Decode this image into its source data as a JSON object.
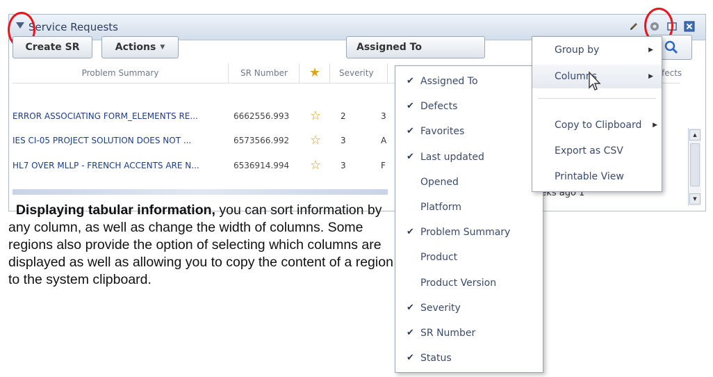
{
  "region": {
    "title": "Service Requests"
  },
  "toolbar": {
    "create_label": "Create SR",
    "actions_label": "Actions",
    "assigned_label": "Assigned To"
  },
  "table": {
    "headers": {
      "summary": "Problem Summary",
      "sr": "SR Number",
      "severity": "Severity",
      "defects": "fects"
    },
    "rows": [
      {
        "summary": "ERROR ASSOCIATING FORM_ELEMENTS RE...",
        "sr": "6662556.993",
        "severity": "2",
        "status": "3"
      },
      {
        "summary": "IES CI-05 PROJECT SOLUTION DOES NOT ...",
        "sr": "6573566.992",
        "severity": "3",
        "status": "A"
      },
      {
        "summary": "HL7 OVER MLLP - FRENCH ACCENTS ARE N...",
        "sr": "6536914.994",
        "severity": "3",
        "status": "F"
      }
    ],
    "partial_row_tail": "gress   19 weeks ago 1"
  },
  "column_menu": {
    "items": [
      {
        "label": "Assigned To",
        "checked": true
      },
      {
        "label": "Defects",
        "checked": true
      },
      {
        "label": "Favorites",
        "checked": true
      },
      {
        "label": "Last updated",
        "checked": true
      },
      {
        "label": "Opened",
        "checked": false
      },
      {
        "label": "Platform",
        "checked": false
      },
      {
        "label": "Problem Summary",
        "checked": true
      },
      {
        "label": "Product",
        "checked": false
      },
      {
        "label": "Product Version",
        "checked": false
      },
      {
        "label": "Severity",
        "checked": true
      },
      {
        "label": "SR Number",
        "checked": true
      },
      {
        "label": "Status",
        "checked": true
      }
    ]
  },
  "gear_menu": {
    "group_by": "Group by",
    "columns": "Columns",
    "copy": "Copy to Clipboard",
    "export": "Export as CSV",
    "printable": "Printable View"
  },
  "description": {
    "bold": "Displaying tabular information,",
    "text": " you can sort information by any column, as well as change the width of columns. Some regions also provide the option of selecting which columns are displayed as well as allowing you to copy the content of a region to the system clipboard."
  },
  "colors": {
    "callout": "#e8151c",
    "link": "#1a3e8c",
    "header_bg": "#d3deeb"
  }
}
